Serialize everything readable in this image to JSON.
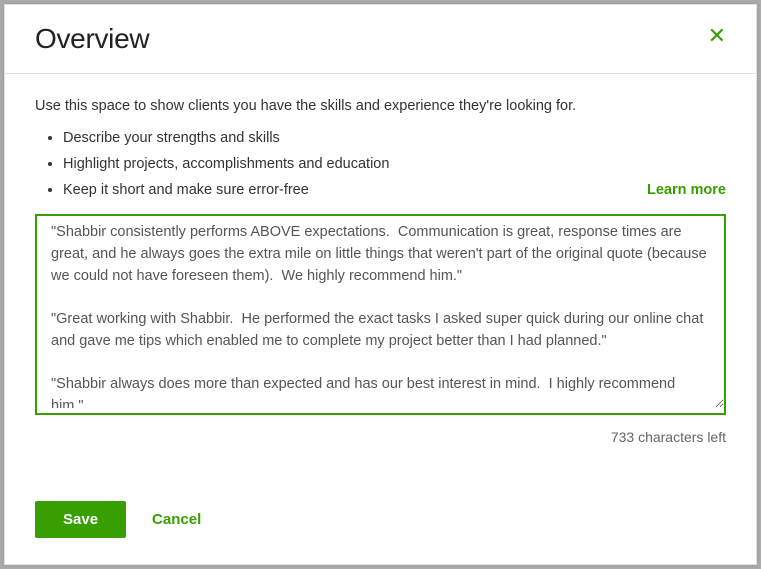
{
  "modal": {
    "title": "Overview",
    "intro": "Use this space to show clients you have the skills and experience they're looking for.",
    "bullets": [
      "Describe your strengths and skills",
      "Highlight projects, accomplishments and education",
      "Keep it short and make sure error-free"
    ],
    "learn_more": "Learn more",
    "textarea_value": "\"Shabbir consistently performs ABOVE expectations.  Communication is great, response times are great, and he always goes the extra mile on little things that weren't part of the original quote (because we could not have foreseen them).  We highly recommend him.\"\n\n\"Great working with Shabbir.  He performed the exact tasks I asked super quick during our online chat and gave me tips which enabled me to complete my project better than I had planned.\"\n\n\"Shabbir always does more than expected and has our best interest in mind.  I highly recommend him.\"",
    "char_count": "733 characters left",
    "save_label": "Save",
    "cancel_label": "Cancel"
  }
}
